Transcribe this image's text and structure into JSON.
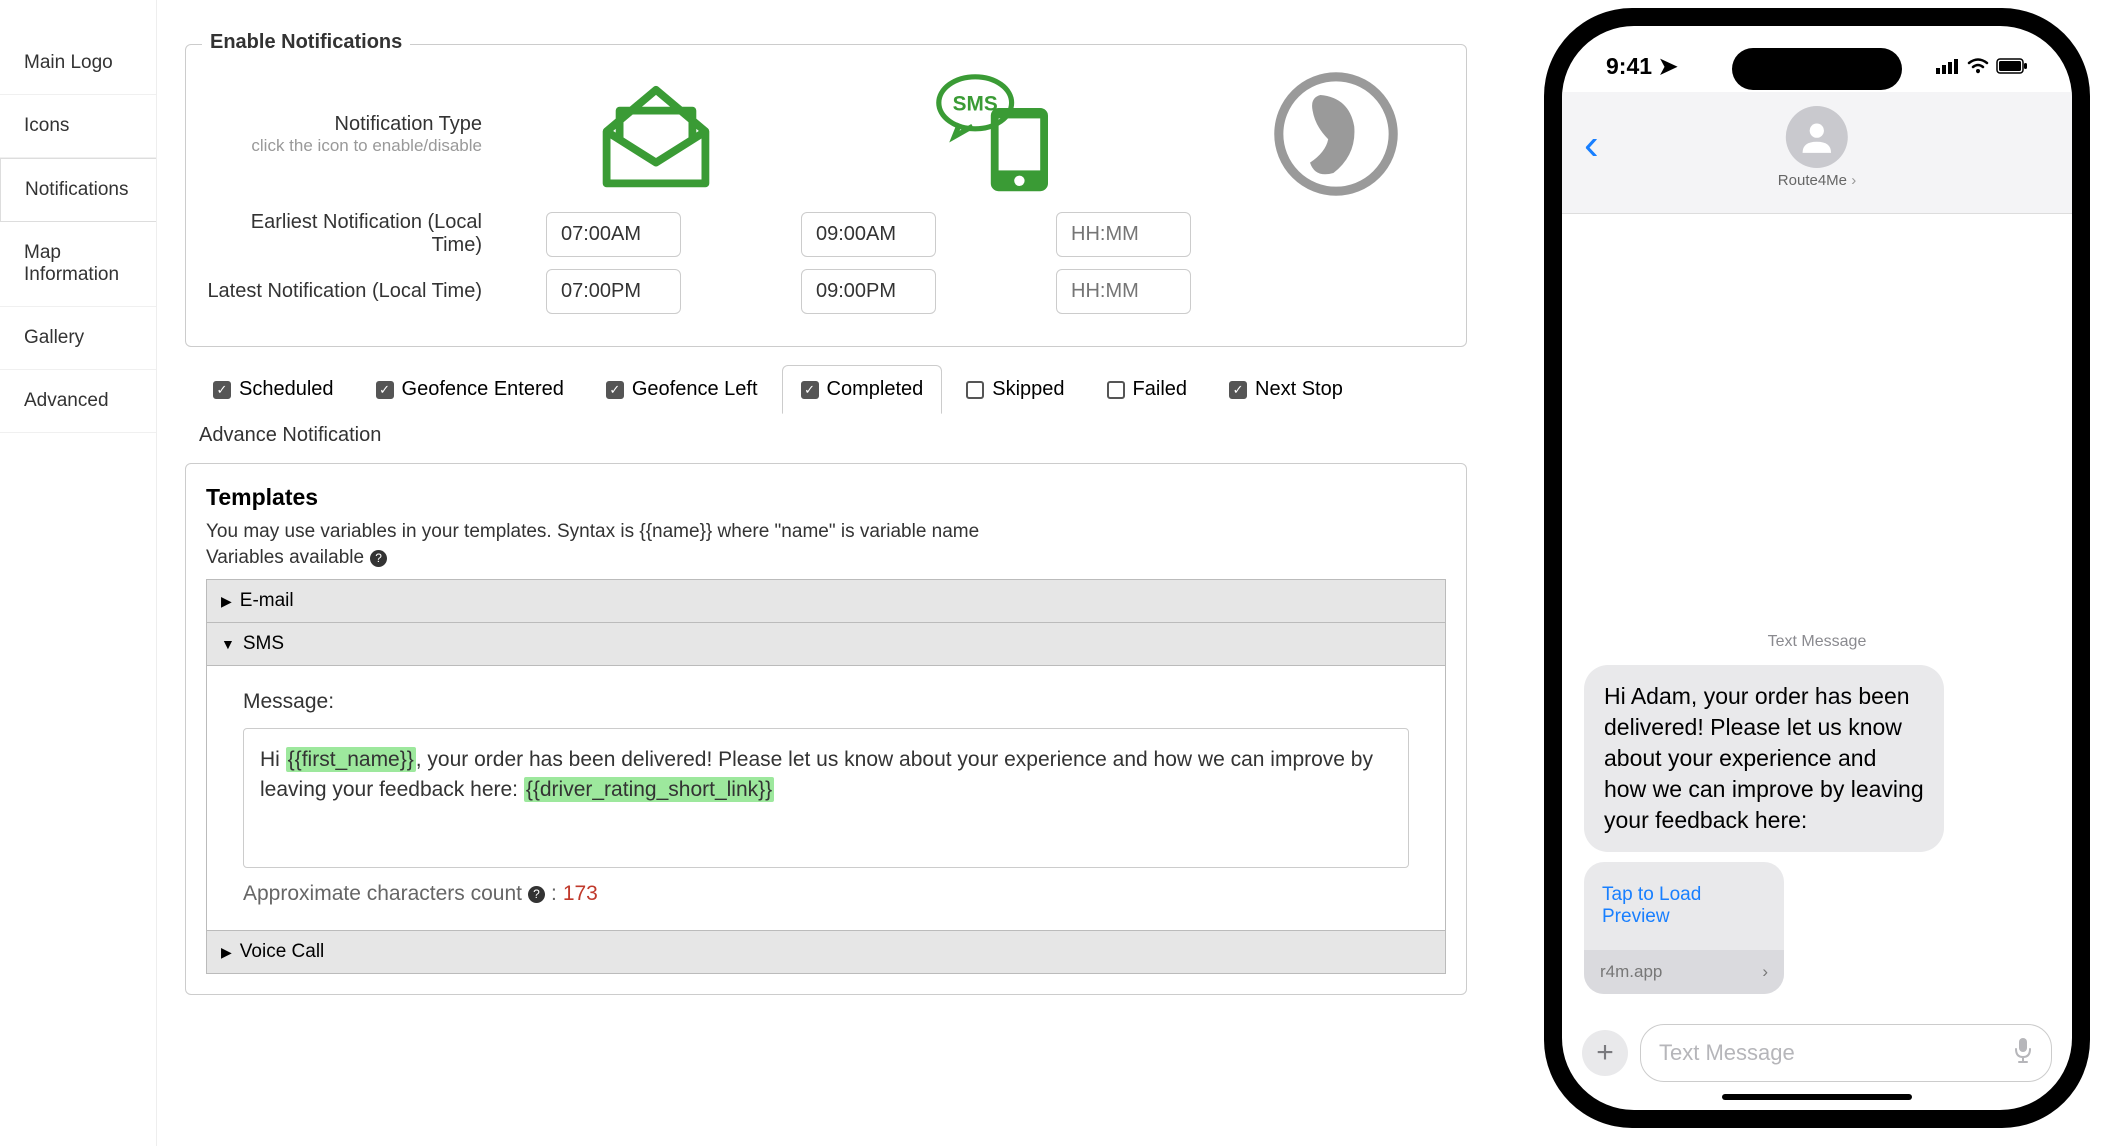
{
  "sidebar": {
    "items": [
      {
        "label": "Main Logo"
      },
      {
        "label": "Icons"
      },
      {
        "label": "Notifications"
      },
      {
        "label": "Map Information"
      },
      {
        "label": "Gallery"
      },
      {
        "label": "Advanced"
      }
    ]
  },
  "fieldset": {
    "legend": "Enable Notifications",
    "type_label": "Notification Type",
    "type_hint": "click the icon to enable/disable",
    "earliest_label": "Earliest Notification (Local Time)",
    "latest_label": "Latest Notification (Local Time)",
    "cols": {
      "email": {
        "earliest": "07:00AM",
        "latest": "07:00PM"
      },
      "sms": {
        "earliest": "09:00AM",
        "latest": "09:00PM"
      },
      "voice": {
        "earliest_placeholder": "HH:MM",
        "latest_placeholder": "HH:MM"
      }
    }
  },
  "tabs": [
    {
      "label": "Scheduled",
      "checked": true
    },
    {
      "label": "Geofence Entered",
      "checked": true
    },
    {
      "label": "Geofence Left",
      "checked": true
    },
    {
      "label": "Completed",
      "checked": true,
      "active": true
    },
    {
      "label": "Skipped",
      "checked": false
    },
    {
      "label": "Failed",
      "checked": false
    },
    {
      "label": "Next Stop",
      "checked": true
    }
  ],
  "advance_link": "Advance Notification",
  "templates": {
    "heading": "Templates",
    "hint": "You may use variables in your templates. Syntax is {{name}} where \"name\" is variable name",
    "vars_label": "Variables available",
    "sections": {
      "email": "E-mail",
      "sms": "SMS",
      "voice": "Voice Call"
    },
    "message_label": "Message:",
    "message_parts": {
      "p1": "Hi ",
      "v1": "{{first_name}}",
      "p2": ", your order has been delivered! Please let us know about your experience and how we can improve by leaving your feedback here: ",
      "v2": "{{driver_rating_short_link}}"
    },
    "char_label": "Approximate characters count ",
    "char_count": "173"
  },
  "phone": {
    "time": "9:41",
    "contact": "Route4Me",
    "text_message_label": "Text Message",
    "bubble": "Hi Adam, your order has been delivered! Please let us know about your experience and how we can improve by leaving your feedback here:",
    "preview_title": "Tap to Load Preview",
    "preview_domain": "r4m.app",
    "compose_placeholder": "Text Message"
  }
}
